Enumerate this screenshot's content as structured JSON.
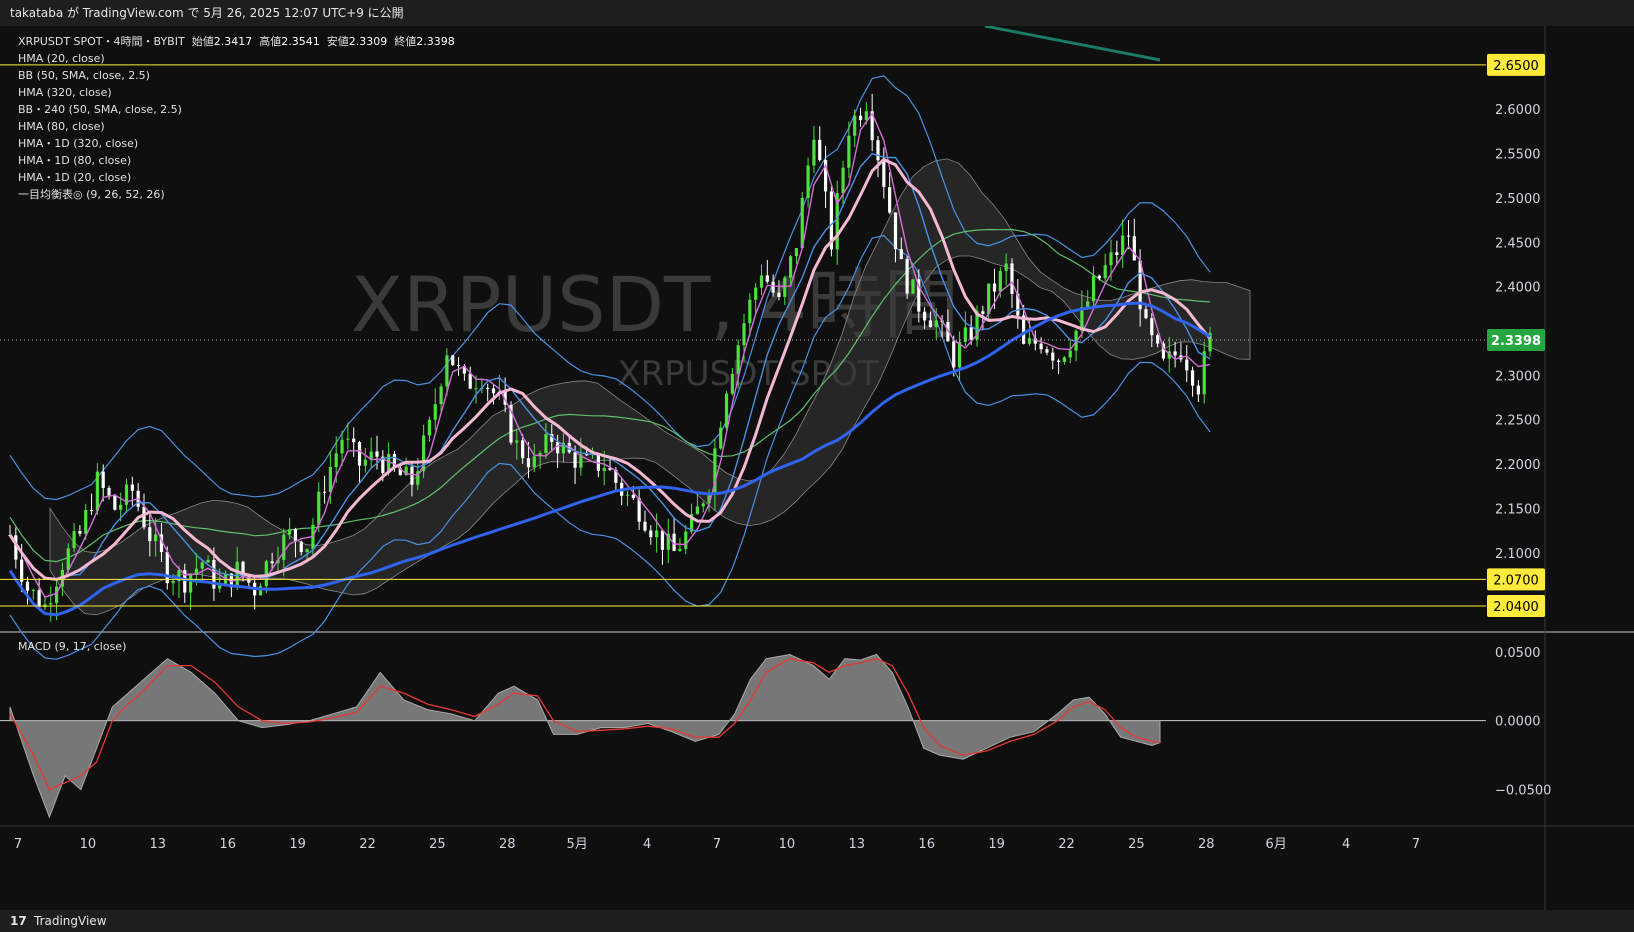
{
  "header": {
    "publish_line": "takataba が TradingView.com で 5月 26, 2025 12:07 UTC+9 に公開"
  },
  "legend": {
    "symbol": "XRPUSDT SPOT・4時間・BYBIT",
    "open_label": "始値",
    "open": "2.3417",
    "high_label": "高値",
    "high": "2.3541",
    "low_label": "安値",
    "low": "2.3309",
    "close_label": "終値",
    "close": "2.3398",
    "indicators": [
      "HMA (20, close)",
      "BB (50, SMA, close, 2.5)",
      "HMA (320, close)",
      "BB・240 (50, SMA, close, 2.5)",
      "HMA (80, close)",
      "HMA・1D (320, close)",
      "HMA・1D (80, close)",
      "HMA・1D (20, close)",
      "一目均衡表◎ (9, 26, 52, 26)"
    ]
  },
  "watermark": {
    "main": "XRPUSDT, 4時間",
    "sub": "XRPUSDT SPOT"
  },
  "macd_label": "MACD (9, 17, close)",
  "footer": {
    "logo": "17",
    "brand": "TradingView"
  },
  "colors": {
    "up": "#4fdf40",
    "down": "#ffffff",
    "hma_fast": "#d36ed6",
    "hma_mid": "#f5b8d3",
    "hma_slow": "#2f63f0",
    "bb": "#4a90e2",
    "bb_mid": "#5fbf6a",
    "level": "#ffeb3b",
    "price_tag": "#26a641",
    "cloud": "#3a3a3a",
    "macd_area": "#8a8a8a",
    "signal": "#e53935",
    "trend": "#1b7a68"
  },
  "chart_data": [
    {
      "type": "candlestick",
      "title": "XRPUSDT SPOT・4時間・BYBIT",
      "y_ticks": [
        "2.6000",
        "2.5500",
        "2.5000",
        "2.4500",
        "2.4000",
        "2.3000",
        "2.2500",
        "2.2000",
        "2.1500",
        "2.1000"
      ],
      "ylim": [
        2.04,
        2.66
      ],
      "x_ticks": [
        "7",
        "10",
        "13",
        "16",
        "19",
        "22",
        "25",
        "28",
        "5月",
        "4",
        "7",
        "10",
        "13",
        "16",
        "19",
        "22",
        "25",
        "28",
        "6月",
        "4",
        "7"
      ],
      "horizontal_levels": [
        2.65,
        2.07,
        2.04
      ],
      "level_labels": [
        "2.6500",
        "2.0700",
        "2.0400"
      ],
      "last_price": 2.3398,
      "last_price_label": "2.3398",
      "ohlc_last": {
        "open": 2.3417,
        "high": 2.3541,
        "low": 2.3309,
        "close": 2.3398
      },
      "price_path": [
        [
          0,
          2.12
        ],
        [
          3,
          2.06
        ],
        [
          6,
          2.04
        ],
        [
          9,
          2.09
        ],
        [
          12,
          2.12
        ],
        [
          15,
          2.18
        ],
        [
          18,
          2.15
        ],
        [
          21,
          2.17
        ],
        [
          24,
          2.12
        ],
        [
          27,
          2.08
        ],
        [
          30,
          2.07
        ],
        [
          33,
          2.09
        ],
        [
          36,
          2.06
        ],
        [
          39,
          2.08
        ],
        [
          42,
          2.06
        ],
        [
          45,
          2.1
        ],
        [
          48,
          2.12
        ],
        [
          51,
          2.11
        ],
        [
          54,
          2.18
        ],
        [
          57,
          2.23
        ],
        [
          60,
          2.2
        ],
        [
          63,
          2.21
        ],
        [
          66,
          2.19
        ],
        [
          69,
          2.18
        ],
        [
          72,
          2.24
        ],
        [
          75,
          2.33
        ],
        [
          78,
          2.29
        ],
        [
          81,
          2.3
        ],
        [
          84,
          2.27
        ],
        [
          87,
          2.22
        ],
        [
          90,
          2.2
        ],
        [
          93,
          2.23
        ],
        [
          96,
          2.21
        ],
        [
          99,
          2.2
        ],
        [
          102,
          2.2
        ],
        [
          105,
          2.17
        ],
        [
          108,
          2.15
        ],
        [
          111,
          2.12
        ],
        [
          114,
          2.1
        ],
        [
          117,
          2.13
        ],
        [
          120,
          2.18
        ],
        [
          123,
          2.29
        ],
        [
          126,
          2.36
        ],
        [
          129,
          2.42
        ],
        [
          132,
          2.38
        ],
        [
          135,
          2.45
        ],
        [
          138,
          2.58
        ],
        [
          141,
          2.45
        ],
        [
          144,
          2.58
        ],
        [
          147,
          2.61
        ],
        [
          150,
          2.52
        ],
        [
          153,
          2.42
        ],
        [
          156,
          2.38
        ],
        [
          159,
          2.36
        ],
        [
          162,
          2.32
        ],
        [
          165,
          2.35
        ],
        [
          168,
          2.39
        ],
        [
          171,
          2.42
        ],
        [
          174,
          2.33
        ],
        [
          177,
          2.34
        ],
        [
          180,
          2.32
        ],
        [
          183,
          2.35
        ],
        [
          186,
          2.4
        ],
        [
          189,
          2.43
        ],
        [
          192,
          2.46
        ],
        [
          195,
          2.35
        ],
        [
          198,
          2.31
        ],
        [
          201,
          2.33
        ],
        [
          204,
          2.29
        ],
        [
          206,
          2.34
        ]
      ]
    },
    {
      "type": "area",
      "title": "MACD (9, 17, close)",
      "y_ticks": [
        "0.0500",
        "0.0000",
        "−0.0500"
      ],
      "ylim": [
        -0.075,
        0.06
      ],
      "macd": [
        [
          0,
          0.01
        ],
        [
          3,
          -0.04
        ],
        [
          5,
          -0.07
        ],
        [
          7,
          -0.04
        ],
        [
          9,
          -0.05
        ],
        [
          11,
          -0.02
        ],
        [
          13,
          0.01
        ],
        [
          15,
          0.02
        ],
        [
          17,
          0.03
        ],
        [
          20,
          0.045
        ],
        [
          23,
          0.035
        ],
        [
          26,
          0.02
        ],
        [
          29,
          0.0
        ],
        [
          32,
          -0.005
        ],
        [
          35,
          -0.003
        ],
        [
          38,
          0.0
        ],
        [
          41,
          0.005
        ],
        [
          44,
          0.01
        ],
        [
          47,
          0.035
        ],
        [
          50,
          0.015
        ],
        [
          53,
          0.008
        ],
        [
          56,
          0.005
        ],
        [
          59,
          0.0
        ],
        [
          62,
          0.02
        ],
        [
          64,
          0.025
        ],
        [
          67,
          0.015
        ],
        [
          69,
          -0.01
        ],
        [
          72,
          -0.01
        ],
        [
          75,
          -0.005
        ],
        [
          78,
          -0.005
        ],
        [
          81,
          -0.002
        ],
        [
          84,
          -0.008
        ],
        [
          87,
          -0.015
        ],
        [
          90,
          -0.01
        ],
        [
          92,
          0.005
        ],
        [
          94,
          0.03
        ],
        [
          96,
          0.045
        ],
        [
          99,
          0.048
        ],
        [
          102,
          0.04
        ],
        [
          104,
          0.03
        ],
        [
          106,
          0.045
        ],
        [
          108,
          0.044
        ],
        [
          110,
          0.048
        ],
        [
          112,
          0.035
        ],
        [
          114,
          0.01
        ],
        [
          116,
          -0.02
        ],
        [
          118,
          -0.025
        ],
        [
          121,
          -0.028
        ],
        [
          124,
          -0.02
        ],
        [
          127,
          -0.012
        ],
        [
          130,
          -0.008
        ],
        [
          133,
          0.005
        ],
        [
          135,
          0.015
        ],
        [
          137,
          0.017
        ],
        [
          139,
          0.005
        ],
        [
          141,
          -0.012
        ],
        [
          143,
          -0.015
        ],
        [
          145,
          -0.018
        ],
        [
          146,
          -0.016
        ]
      ],
      "signal": [
        [
          0,
          0.005
        ],
        [
          3,
          -0.025
        ],
        [
          5,
          -0.05
        ],
        [
          7,
          -0.045
        ],
        [
          9,
          -0.04
        ],
        [
          11,
          -0.03
        ],
        [
          13,
          0.0
        ],
        [
          15,
          0.012
        ],
        [
          17,
          0.022
        ],
        [
          20,
          0.04
        ],
        [
          23,
          0.04
        ],
        [
          26,
          0.028
        ],
        [
          29,
          0.01
        ],
        [
          32,
          0.0
        ],
        [
          35,
          -0.002
        ],
        [
          38,
          -0.001
        ],
        [
          41,
          0.002
        ],
        [
          44,
          0.006
        ],
        [
          47,
          0.025
        ],
        [
          50,
          0.02
        ],
        [
          53,
          0.012
        ],
        [
          56,
          0.008
        ],
        [
          59,
          0.003
        ],
        [
          62,
          0.012
        ],
        [
          64,
          0.02
        ],
        [
          67,
          0.018
        ],
        [
          69,
          0.0
        ],
        [
          72,
          -0.008
        ],
        [
          75,
          -0.007
        ],
        [
          78,
          -0.006
        ],
        [
          81,
          -0.004
        ],
        [
          84,
          -0.006
        ],
        [
          87,
          -0.012
        ],
        [
          90,
          -0.012
        ],
        [
          92,
          -0.002
        ],
        [
          94,
          0.015
        ],
        [
          96,
          0.035
        ],
        [
          99,
          0.045
        ],
        [
          102,
          0.042
        ],
        [
          104,
          0.035
        ],
        [
          106,
          0.04
        ],
        [
          108,
          0.042
        ],
        [
          110,
          0.045
        ],
        [
          112,
          0.04
        ],
        [
          114,
          0.02
        ],
        [
          116,
          -0.005
        ],
        [
          118,
          -0.018
        ],
        [
          121,
          -0.025
        ],
        [
          124,
          -0.022
        ],
        [
          127,
          -0.015
        ],
        [
          130,
          -0.01
        ],
        [
          133,
          0.0
        ],
        [
          135,
          0.01
        ],
        [
          137,
          0.014
        ],
        [
          139,
          0.008
        ],
        [
          141,
          -0.005
        ],
        [
          143,
          -0.012
        ],
        [
          145,
          -0.015
        ],
        [
          146,
          -0.016
        ]
      ]
    }
  ]
}
